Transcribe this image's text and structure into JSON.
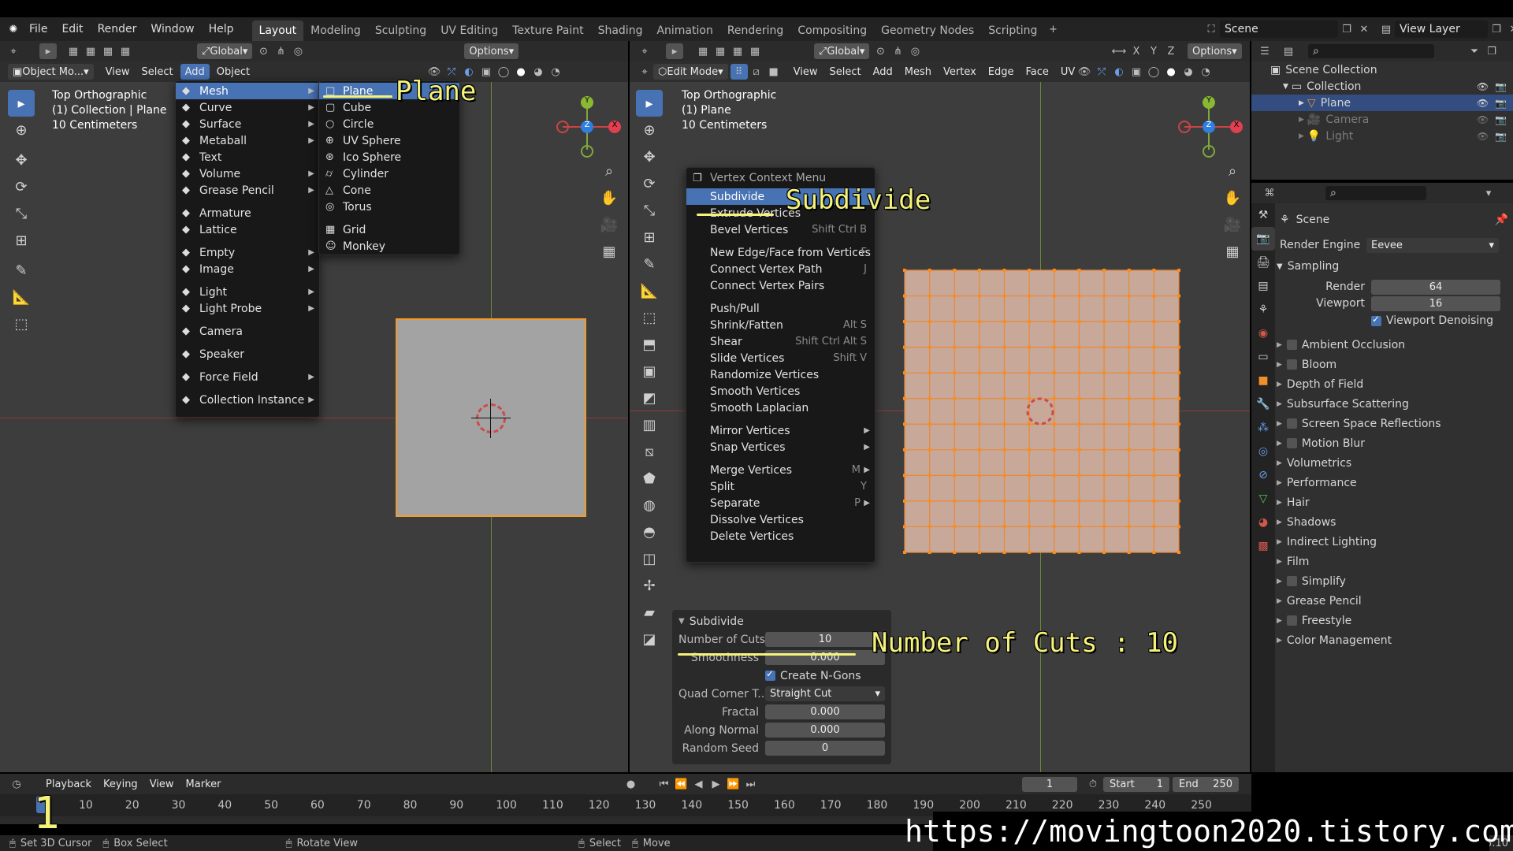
{
  "app": {
    "menus": [
      "File",
      "Edit",
      "Render",
      "Window",
      "Help"
    ]
  },
  "workspaces": [
    "Layout",
    "Modeling",
    "Sculpting",
    "UV Editing",
    "Texture Paint",
    "Shading",
    "Animation",
    "Rendering",
    "Compositing",
    "Geometry Nodes",
    "Scripting"
  ],
  "scene_name": "Scene",
  "view_layer": "View Layer",
  "left_viewport": {
    "mode": "Object Mo...",
    "menus": [
      "View",
      "Select",
      "Add",
      "Object"
    ],
    "transform": "Global",
    "options": "Options",
    "view_name": "Top Orthographic",
    "collection": "(1) Collection | Plane",
    "scale": "10 Centimeters"
  },
  "add_menu": {
    "items": [
      {
        "label": "Mesh",
        "icon": "mesh-icon",
        "sub": true
      },
      {
        "label": "Curve",
        "icon": "curve-icon",
        "sub": true
      },
      {
        "label": "Surface",
        "icon": "surface-icon",
        "sub": true
      },
      {
        "label": "Metaball",
        "icon": "metaball-icon",
        "sub": true
      },
      {
        "label": "Text",
        "icon": "text-icon",
        "sub": false
      },
      {
        "label": "Volume",
        "icon": "volume-icon",
        "sub": true
      },
      {
        "label": "Grease Pencil",
        "icon": "grease-pencil-icon",
        "sub": true
      },
      {
        "label": "Armature",
        "icon": "armature-icon",
        "sub": false
      },
      {
        "label": "Lattice",
        "icon": "lattice-icon",
        "sub": false
      },
      {
        "label": "Empty",
        "icon": "empty-icon",
        "sub": true
      },
      {
        "label": "Image",
        "icon": "image-icon",
        "sub": true
      },
      {
        "label": "Light",
        "icon": "light-icon",
        "sub": true
      },
      {
        "label": "Light Probe",
        "icon": "light-probe-icon",
        "sub": true
      },
      {
        "label": "Camera",
        "icon": "camera-icon",
        "sub": false
      },
      {
        "label": "Speaker",
        "icon": "speaker-icon",
        "sub": false
      },
      {
        "label": "Force Field",
        "icon": "force-field-icon",
        "sub": true
      },
      {
        "label": "Collection Instance",
        "icon": "collection-instance-icon",
        "sub": true
      }
    ]
  },
  "mesh_menu": {
    "items": [
      "Plane",
      "Cube",
      "Circle",
      "UV Sphere",
      "Ico Sphere",
      "Cylinder",
      "Cone",
      "Torus",
      "Grid",
      "Monkey"
    ]
  },
  "annotations": {
    "plane": "Plane",
    "subdivide": "Subdivide",
    "cuts": "Number of Cuts : 10",
    "url": "https://movingtoon2020.tistory.com",
    "frame_badge": "1"
  },
  "right_viewport": {
    "mode": "Edit Mode",
    "menus": [
      "View",
      "Select",
      "Add",
      "Mesh",
      "Vertex",
      "Edge",
      "Face",
      "UV"
    ],
    "transform": "Global",
    "options": "Options",
    "axes": [
      "X",
      "Y",
      "Z"
    ],
    "view_name": "Top Orthographic",
    "object": "(1) Plane",
    "scale": "10 Centimeters"
  },
  "vertex_menu": {
    "title": "Vertex Context Menu",
    "items": [
      {
        "label": "Subdivide",
        "shortcut": "",
        "sub": false
      },
      {
        "label": "Extrude Vertices",
        "shortcut": "",
        "sub": false
      },
      {
        "label": "Bevel Vertices",
        "shortcut": "Shift Ctrl B",
        "sub": false
      },
      {
        "label": "New Edge/Face from Vertices",
        "shortcut": "F",
        "sub": false
      },
      {
        "label": "Connect Vertex Path",
        "shortcut": "J",
        "sub": false
      },
      {
        "label": "Connect Vertex Pairs",
        "shortcut": "",
        "sub": false
      },
      {
        "label": "Push/Pull",
        "shortcut": "",
        "sub": false
      },
      {
        "label": "Shrink/Fatten",
        "shortcut": "Alt S",
        "sub": false
      },
      {
        "label": "Shear",
        "shortcut": "Shift Ctrl Alt S",
        "sub": false
      },
      {
        "label": "Slide Vertices",
        "shortcut": "Shift V",
        "sub": false
      },
      {
        "label": "Randomize Vertices",
        "shortcut": "",
        "sub": false
      },
      {
        "label": "Smooth Vertices",
        "shortcut": "",
        "sub": false
      },
      {
        "label": "Smooth Laplacian",
        "shortcut": "",
        "sub": false
      },
      {
        "label": "Mirror Vertices",
        "shortcut": "",
        "sub": true
      },
      {
        "label": "Snap Vertices",
        "shortcut": "",
        "sub": true
      },
      {
        "label": "Merge Vertices",
        "shortcut": "M",
        "sub": true
      },
      {
        "label": "Split",
        "shortcut": "Y",
        "sub": false
      },
      {
        "label": "Separate",
        "shortcut": "P",
        "sub": true
      },
      {
        "label": "Dissolve Vertices",
        "shortcut": "",
        "sub": false
      },
      {
        "label": "Delete Vertices",
        "shortcut": "",
        "sub": false
      }
    ]
  },
  "subdivide_panel": {
    "title": "Subdivide",
    "cuts_label": "Number of Cuts",
    "cuts_value": "10",
    "smooth_label": "Smoothness",
    "smooth_value": "0.000",
    "ngons_label": "Create N-Gons",
    "quad_label": "Quad Corner T...",
    "quad_value": "Straight Cut",
    "fractal_label": "Fractal",
    "fractal_value": "0.000",
    "normal_label": "Along Normal",
    "normal_value": "0.000",
    "seed_label": "Random Seed",
    "seed_value": "0"
  },
  "outliner": {
    "scene_collection": "Scene Collection",
    "items": [
      {
        "label": "Collection",
        "icon": "collection-icon",
        "selected": false
      },
      {
        "label": "Plane",
        "icon": "mesh-object-icon",
        "selected": true
      },
      {
        "label": "Camera",
        "icon": "camera-object-icon",
        "selected": false
      },
      {
        "label": "Light",
        "icon": "light-object-icon",
        "selected": false
      }
    ]
  },
  "properties": {
    "tab_title": "Scene",
    "render_engine_label": "Render Engine",
    "render_engine": "Eevee",
    "sampling_title": "Sampling",
    "render_label": "Render",
    "render_value": "64",
    "viewport_label": "Viewport",
    "viewport_value": "16",
    "denoise_label": "Viewport Denoising",
    "sections": [
      {
        "label": "Ambient Occlusion",
        "checkbox": true
      },
      {
        "label": "Bloom",
        "checkbox": true
      },
      {
        "label": "Depth of Field",
        "checkbox": false
      },
      {
        "label": "Subsurface Scattering",
        "checkbox": false
      },
      {
        "label": "Screen Space Reflections",
        "checkbox": true
      },
      {
        "label": "Motion Blur",
        "checkbox": true
      },
      {
        "label": "Volumetrics",
        "checkbox": false
      },
      {
        "label": "Performance",
        "checkbox": false
      },
      {
        "label": "Hair",
        "checkbox": false
      },
      {
        "label": "Shadows",
        "checkbox": false
      },
      {
        "label": "Indirect Lighting",
        "checkbox": false
      },
      {
        "label": "Film",
        "checkbox": false
      },
      {
        "label": "Simplify",
        "checkbox": true
      },
      {
        "label": "Grease Pencil",
        "checkbox": false
      },
      {
        "label": "Freestyle",
        "checkbox": true
      },
      {
        "label": "Color Management",
        "checkbox": false
      }
    ]
  },
  "timeline": {
    "menus": [
      "Playback",
      "Keying",
      "View",
      "Marker"
    ],
    "current_frame": "1",
    "start_label": "Start",
    "start": "1",
    "end_label": "End",
    "end": "250",
    "ticks": [
      "10",
      "20",
      "30",
      "40",
      "50",
      "60",
      "70",
      "80",
      "90",
      "100",
      "110",
      "120",
      "130",
      "140",
      "150",
      "160",
      "170",
      "180",
      "190",
      "200",
      "210",
      "220",
      "230",
      "240",
      "250"
    ]
  },
  "status": {
    "items": [
      "Set 3D Cursor",
      "Box Select",
      "Rotate View",
      "Select",
      "Move"
    ],
    "version": "3.10"
  },
  "colors": {
    "accent": "#4772b3",
    "annotation": "#f4f27a",
    "vertex": "#ff8c19",
    "face": "#c8a898"
  }
}
